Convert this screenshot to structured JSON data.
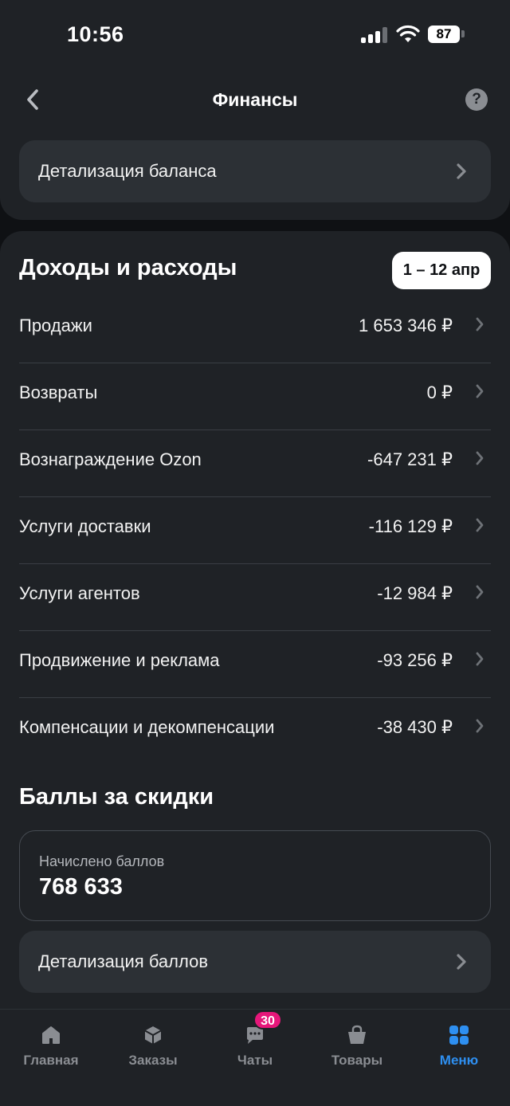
{
  "status_bar": {
    "time": "10:56",
    "battery": "87"
  },
  "header": {
    "title": "Финансы",
    "help_label": "?"
  },
  "balance_detail": {
    "label": "Детализация баланса"
  },
  "income_expenses": {
    "title": "Доходы и расходы",
    "period": "1 – 12 апр",
    "rows": [
      {
        "name": "Продажи",
        "amount": "1 653 346 ₽"
      },
      {
        "name": "Возвраты",
        "amount": "0 ₽"
      },
      {
        "name": "Вознаграждение Ozon",
        "amount": "-647 231 ₽"
      },
      {
        "name": "Услуги доставки",
        "amount": "-116 129 ₽"
      },
      {
        "name": "Услуги агентов",
        "amount": "-12 984 ₽"
      },
      {
        "name": "Продвижение и реклама",
        "amount": "-93 256 ₽"
      },
      {
        "name": "Компенсации и декомпенсации",
        "amount": "-38 430 ₽"
      }
    ]
  },
  "discount_points": {
    "title": "Баллы за скидки",
    "accrued_label": "Начислено баллов",
    "accrued_value": "768 633",
    "detail_label": "Детализация баллов"
  },
  "tab_bar": {
    "tabs": [
      {
        "label": "Главная",
        "icon": "home-icon"
      },
      {
        "label": "Заказы",
        "icon": "box-icon"
      },
      {
        "label": "Чаты",
        "icon": "chat-icon",
        "badge": "30"
      },
      {
        "label": "Товары",
        "icon": "bag-icon"
      },
      {
        "label": "Меню",
        "icon": "grid-icon",
        "active": true
      }
    ]
  },
  "colors": {
    "accent": "#2e8ff0",
    "badge": "#e6177a",
    "card": "#1f2226",
    "background": "#0f1114"
  }
}
